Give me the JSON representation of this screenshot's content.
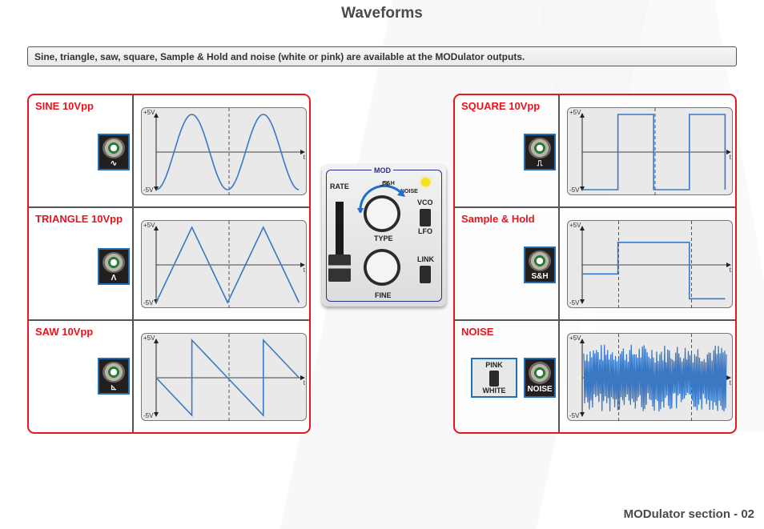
{
  "page": {
    "title": "Waveforms",
    "info": "Sine, triangle, saw, square, Sample & Hold and noise (white or pink) are available at the MODulator outputs.",
    "footer": "MODulator section - 02"
  },
  "colors": {
    "accent_red": "#e8141e",
    "wave_blue": "#3b78c4",
    "panel_blue": "#2a2f8a",
    "jack_border": "#1f6fb5",
    "led_yellow": "#f2e21a"
  },
  "scope_axis": {
    "top_label": "+5V",
    "bottom_label": "-5V",
    "x_label": "t"
  },
  "waveforms": [
    {
      "id": "sine",
      "label": "SINE 10Vpp",
      "jack_symbol": "∿",
      "icon": "sine-jack-icon"
    },
    {
      "id": "triangle",
      "label": "TRIANGLE 10Vpp",
      "jack_symbol": "Λ",
      "icon": "triangle-jack-icon"
    },
    {
      "id": "saw",
      "label": "SAW 10Vpp",
      "jack_symbol": "⊾",
      "icon": "saw-jack-icon"
    },
    {
      "id": "square",
      "label": "SQUARE 10Vpp",
      "jack_symbol": "⎍",
      "icon": "square-jack-icon"
    },
    {
      "id": "sh",
      "label": "Sample & Hold",
      "jack_symbol": "S&H",
      "icon": "sample-hold-jack-icon"
    },
    {
      "id": "noise",
      "label": "NOISE",
      "jack_symbol": "NOISE",
      "icon": "noise-jack-icon",
      "switch": {
        "top": "PINK",
        "bottom": "WHITE"
      }
    }
  ],
  "chart_data": [
    {
      "type": "line",
      "title": "SINE 10Vpp",
      "ylim": [
        -5,
        5
      ],
      "ylabel_top": "+5V",
      "ylabel_bottom": "-5V",
      "xlabel": "t",
      "series": [
        {
          "name": "sine",
          "shape": "sine",
          "cycles": 2,
          "amplitude": 5,
          "start_phase": "minimum"
        }
      ]
    },
    {
      "type": "line",
      "title": "TRIANGLE 10Vpp",
      "ylim": [
        -5,
        5
      ],
      "xlabel": "t",
      "series": [
        {
          "name": "triangle",
          "shape": "triangle",
          "cycles": 2,
          "amplitude": 5,
          "start_phase": "minimum"
        }
      ]
    },
    {
      "type": "line",
      "title": "SAW 10Vpp",
      "ylim": [
        -5,
        5
      ],
      "xlabel": "t",
      "series": [
        {
          "name": "saw",
          "shape": "saw-down",
          "x": [
            0,
            1,
            1,
            2,
            3,
            3,
            4
          ],
          "y": [
            0,
            -5,
            5,
            0,
            -5,
            5,
            0
          ]
        }
      ]
    },
    {
      "type": "line",
      "title": "SQUARE 10Vpp",
      "ylim": [
        -5,
        5
      ],
      "xlabel": "t",
      "series": [
        {
          "name": "square",
          "x": [
            0,
            1,
            1,
            2,
            2,
            3,
            3,
            4,
            4
          ],
          "y": [
            -5,
            -5,
            5,
            5,
            -5,
            -5,
            5,
            5,
            -5
          ]
        }
      ]
    },
    {
      "type": "line",
      "title": "Sample & Hold",
      "ylim": [
        -5,
        5
      ],
      "xlabel": "t",
      "series": [
        {
          "name": "sample-hold",
          "x": [
            0,
            1,
            1,
            3,
            3,
            4
          ],
          "y": [
            -1.2,
            -1.2,
            3,
            3,
            -4.5,
            -4.5
          ]
        }
      ]
    },
    {
      "type": "line",
      "title": "NOISE",
      "ylim": [
        -5,
        5
      ],
      "xlabel": "t",
      "series": [
        {
          "name": "noise",
          "shape": "random",
          "amplitude_range": [
            -4.5,
            4.5
          ]
        }
      ]
    }
  ],
  "mod_panel": {
    "title": "MOD",
    "rate": "RATE",
    "type": "TYPE",
    "fine": "FINE",
    "vco": "VCO",
    "lfo": "LFO",
    "link": "LINK",
    "sh": "S&H",
    "noise": "NOISE"
  }
}
